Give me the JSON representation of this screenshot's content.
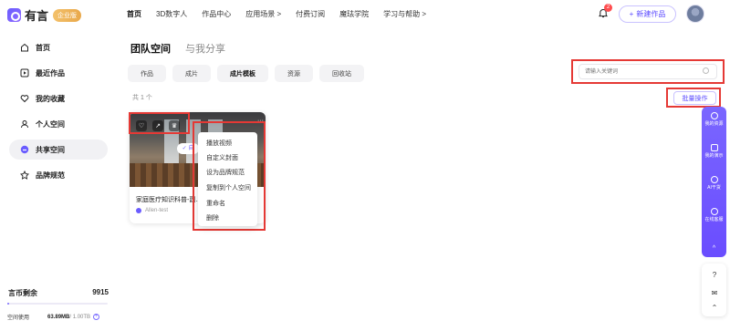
{
  "brand": {
    "name": "有言",
    "badge": "企业版"
  },
  "nav": [
    "首页",
    "3D数字人",
    "作品中心",
    "应用场景 >",
    "付费订阅",
    "魔珐学院",
    "学习与帮助 >"
  ],
  "header": {
    "notification_count": "2",
    "new_button": "新建作品"
  },
  "sidebar": {
    "items": [
      {
        "label": "首页",
        "icon": "home-icon"
      },
      {
        "label": "最近作品",
        "icon": "play-square-icon"
      },
      {
        "label": "我的收藏",
        "icon": "heart-icon"
      },
      {
        "label": "个人空间",
        "icon": "user-icon"
      },
      {
        "label": "共享空间",
        "icon": "share-space-icon",
        "active": true
      },
      {
        "label": "品牌规范",
        "icon": "brand-icon"
      }
    ],
    "coins_label": "言币剩余",
    "coins_value": "9915",
    "storage_label": "空间使用",
    "storage_used": "63.89MB",
    "storage_total": " / 1.00TB",
    "storage_fraction": 0.0001
  },
  "main": {
    "tabs": [
      "团队空间",
      "与我分享"
    ],
    "filters": [
      "作品",
      "成片",
      "成片模板",
      "资源",
      "回收站"
    ],
    "active_filter": "成片模板",
    "count_text": "共 1 个",
    "search_placeholder": "请输入关键词",
    "batch_label": "批量操作"
  },
  "card": {
    "title": "家庭医疗知识科普-副...",
    "author": "Allen-test",
    "chip": "✓ 自",
    "more": "···",
    "menu": [
      "播放视频",
      "自定义封面",
      "设为品牌规范",
      "复制到个人空间",
      "重命名",
      "删除"
    ]
  },
  "float_bar": {
    "items": [
      "我的资源",
      "我的演示",
      "AI干货",
      "在线客服"
    ],
    "collapse": "^"
  },
  "colors": {
    "accent": "#6a5cff",
    "highlight": "#e53935",
    "badge_red": "#ff4d4f"
  }
}
